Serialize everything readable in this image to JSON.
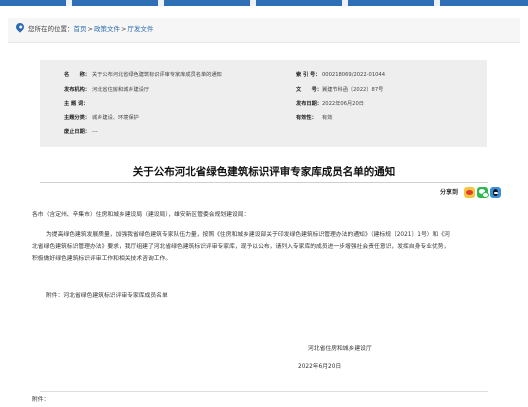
{
  "nav": {
    "tabs": [
      "",
      "",
      "",
      "",
      "",
      ""
    ]
  },
  "breadcrumb": {
    "prefix": "您所在的位置：",
    "items": [
      "首页",
      "政策文件",
      "厅发文件"
    ],
    "separator": ">"
  },
  "info": {
    "title_label": "名　　称：",
    "title_value": "关于公布河北省绿色建筑标识评审专家库成员名单的通知",
    "index_label": "索 引 号：",
    "index_value": "000218069/2022-01044",
    "issuer_label": "发布机构：",
    "issuer_value": "河北省住房和城乡建设厅",
    "docno_label": "文　　号：",
    "docno_value": "冀建节科函〔2022〕87号",
    "subject_label": "主 题 词：",
    "subject_value": "",
    "date_label": "发布日期：",
    "date_value": "2022年06月20日",
    "category_label": "主题分类：",
    "category_value": "城乡建设、环境保护",
    "validity_label": "有效性：",
    "validity_value": "有效",
    "abolish_label": "废止日期：",
    "abolish_value": "---"
  },
  "article": {
    "title": "关于公布河北省绿色建筑标识评审专家库成员名单的通知",
    "share_label": "分享到",
    "salutation": "各市（含定州、辛集市）住房和城乡建设局（建设局），雄安新区管委会规划建设局：",
    "para1_line1": "为提高绿色建筑发展质量，加强我省绿色建筑专家队伍力量，按照《住房和城乡建设部关于印发绿色建筑标识管理办法的通知》（建标规〔2021〕1号）和《河",
    "para1_line2": "北省绿色建筑标识管理办法》要求，我厅组建了河北省绿色建筑标识评审专家库，现予以公布，请列入专家库的成员进一步增强社会责任意识，发挥自身专业优势，",
    "para1_line3": "积极做好绿色建筑标识评审工作和相关技术咨询工作。",
    "attachment_line": "附件：河北省绿色建筑标识评审专家库成员名单",
    "signature": "河北省住房和城乡建设厅",
    "date": "2022年6月20日",
    "attach_label": "附件："
  }
}
